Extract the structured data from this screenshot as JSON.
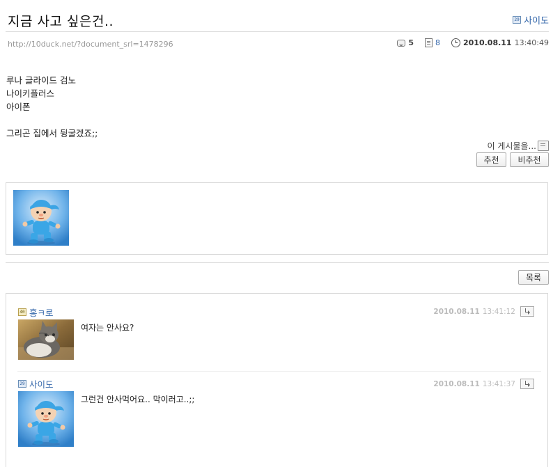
{
  "post": {
    "title": "지금 사고 싶은건..",
    "author": "사이도",
    "url": "http://10duck.net/?document_srl=1478296",
    "comment_count": "5",
    "read_count": "8",
    "date": "2010.08.11",
    "time": "13:40:49",
    "body_lines": [
      "루나 글라이드 검노",
      "나이키플러스",
      "아이폰",
      "",
      "그리곤 집에서 뒹굴겠죠;;"
    ]
  },
  "vote": {
    "label": "이 게시물을...",
    "recommend": "추천",
    "unrecommend": "비추천"
  },
  "nav": {
    "list_button": "목록"
  },
  "comments": [
    {
      "author": "홍ㅋ로",
      "level_badge": "40",
      "date": "2010.08.11",
      "time": "13:41:12",
      "text": "여자는 안사요?"
    },
    {
      "author": "사이도",
      "level_badge": "29",
      "date": "2010.08.11",
      "time": "13:41:37",
      "text": "그런건 안사먹어요.. 막이러고..;;"
    }
  ],
  "icons": [
    "comment-icon",
    "document-icon",
    "clock-icon",
    "print-icon",
    "reply-icon",
    "level-badge-icon"
  ],
  "colors": {
    "link": "#3366aa",
    "meta_date_muted": "#bbbbbb",
    "border": "#d8d8d8"
  }
}
